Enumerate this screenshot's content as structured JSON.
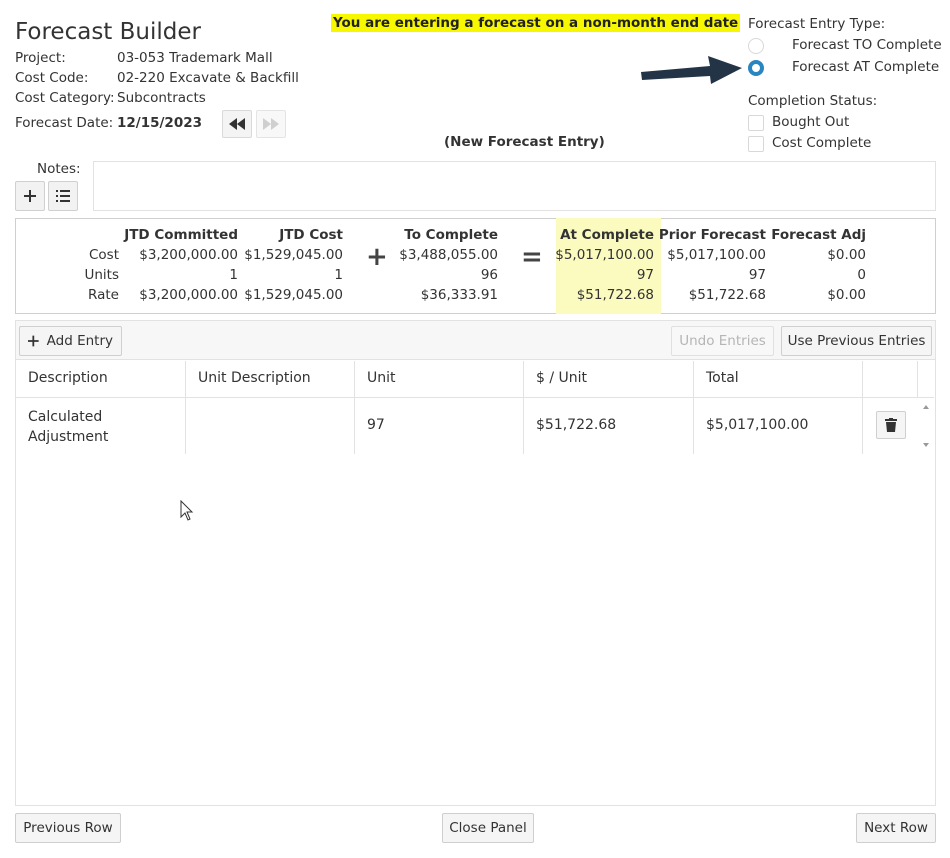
{
  "title": "Forecast Builder",
  "warning": "You are entering a forecast on a non-month end date",
  "new_entry_label": "(New Forecast Entry)",
  "meta": {
    "project_label": "Project:",
    "project_value": "03-053 Trademark Mall",
    "cost_code_label": "Cost Code:",
    "cost_code_value": "02-220 Excavate & Backfill",
    "cost_category_label": "Cost Category:",
    "cost_category_value": "Subcontracts",
    "forecast_date_label": "Forecast Date:",
    "forecast_date_value": "12/15/2023"
  },
  "entry_type": {
    "label": "Forecast Entry Type:",
    "options": [
      "Forecast TO Complete",
      "Forecast AT Complete"
    ],
    "selected": "Forecast AT Complete"
  },
  "completion": {
    "label": "Completion Status:",
    "bought_out": "Bought Out",
    "cost_complete": "Cost Complete"
  },
  "notes_label": "Notes:",
  "summary": {
    "row_labels": [
      "Cost",
      "Units",
      "Rate"
    ],
    "columns": [
      {
        "header": "JTD Committed",
        "values": [
          "$3,200,000.00",
          "1",
          "$3,200,000.00"
        ]
      },
      {
        "header": "JTD Cost",
        "values": [
          "$1,529,045.00",
          "1",
          "$1,529,045.00"
        ]
      },
      {
        "header": "To Complete",
        "values": [
          "$3,488,055.00",
          "96",
          "$36,333.91"
        ]
      },
      {
        "header": "At Complete",
        "values": [
          "$5,017,100.00",
          "97",
          "$51,722.68"
        ]
      },
      {
        "header": "Prior Forecast",
        "values": [
          "$5,017,100.00",
          "97",
          "$51,722.68"
        ]
      },
      {
        "header": "Forecast Adj",
        "values": [
          "$0.00",
          "0",
          "$0.00"
        ]
      }
    ],
    "plus": "+",
    "equals": "="
  },
  "toolbar": {
    "add_entry": "Add Entry",
    "undo_entries": "Undo Entries",
    "use_previous": "Use Previous Entries"
  },
  "grid": {
    "headers": [
      "Description",
      "Unit Description",
      "Unit",
      "$ / Unit",
      "Total"
    ],
    "rows": [
      {
        "description": "Calculated Adjustment",
        "description_line1": "Calculated",
        "description_line2": "Adjustment",
        "unit_description": "",
        "unit": "97",
        "per_unit": "$51,722.68",
        "total": "$5,017,100.00"
      }
    ]
  },
  "footer": {
    "previous_row": "Previous Row",
    "close_panel": "Close Panel",
    "next_row": "Next Row"
  },
  "colors": {
    "warning_bg": "#f7f700",
    "highlight_bg": "#fbfbbf",
    "radio_selected": "#2a86c0",
    "arrow": "#243447"
  }
}
